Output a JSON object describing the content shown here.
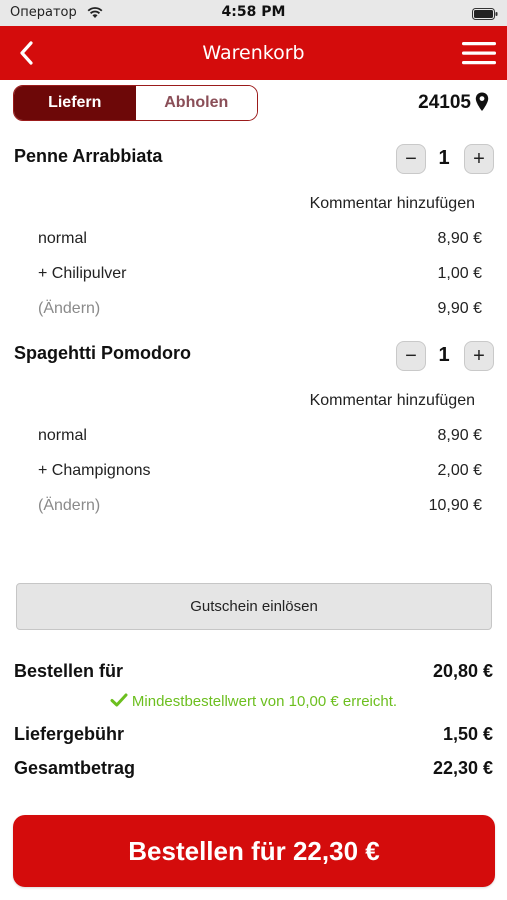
{
  "status_bar": {
    "carrier": "Оператор",
    "time": "4:58 PM"
  },
  "nav": {
    "title": "Warenkorb",
    "back_icon": "chevron-left-icon",
    "menu_icon": "hamburger-menu-icon"
  },
  "colors": {
    "brand": "#d40c0c",
    "segment_active": "#6d0808",
    "success": "#6cbf1f"
  },
  "delivery_toggle": {
    "options": [
      "Liefern",
      "Abholen"
    ],
    "selected": "Liefern"
  },
  "location": {
    "zip": "24105",
    "icon": "map-pin-icon"
  },
  "cart": {
    "items": [
      {
        "name": "Penne Arrabbiata",
        "qty": "1",
        "minus": "−",
        "plus": "+",
        "comment_link": "Kommentar hinzufügen",
        "lines": [
          {
            "label": "normal",
            "price": "8,90 €"
          },
          {
            "label": "+ Chilipulver",
            "price": "1,00 €"
          },
          {
            "label": "(Ändern)",
            "price": "9,90 €"
          }
        ]
      },
      {
        "name": "Spagehtti Pomodoro",
        "qty": "1",
        "minus": "−",
        "plus": "+",
        "comment_link": "Kommentar hinzufügen",
        "lines": [
          {
            "label": "normal",
            "price": "8,90 €"
          },
          {
            "label": "+ Champignons",
            "price": "2,00 €"
          },
          {
            "label": "(Ändern)",
            "price": "10,90 €"
          }
        ]
      }
    ]
  },
  "voucher_button": "Gutschein einlösen",
  "summary": {
    "order_for_label": "Bestellen für",
    "order_for_value": "20,80 €",
    "min_order_msg": "Mindestbestellwert von 10,00 € erreicht.",
    "delivery_fee_label": "Liefergebühr",
    "delivery_fee_value": "1,50 €",
    "total_label": "Gesamtbetrag",
    "total_value": "22,30 €"
  },
  "order_button": "Bestellen für 22,30 €"
}
